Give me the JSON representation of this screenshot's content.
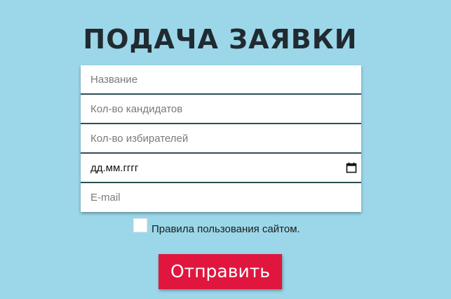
{
  "page": {
    "title": "ПОДАЧА ЗАЯВКИ"
  },
  "form": {
    "fields": [
      {
        "placeholder": "Название",
        "value": ""
      },
      {
        "placeholder": "Кол-во кандидатов",
        "value": ""
      },
      {
        "placeholder": "Кол-во избирателей",
        "value": ""
      },
      {
        "placeholder": "",
        "value": "дд.мм.гггг"
      },
      {
        "placeholder": "E-mail",
        "value": ""
      }
    ],
    "agree_label": "Правила пользования сайтом.",
    "agree_checked": false,
    "submit_label": "Отправить"
  },
  "icons": {
    "date_picker": "calendar-icon"
  },
  "colors": {
    "background": "#9bd7e9",
    "accent_button": "#e0163f",
    "title_text": "#222a31",
    "field_border": "#2e4f58"
  }
}
